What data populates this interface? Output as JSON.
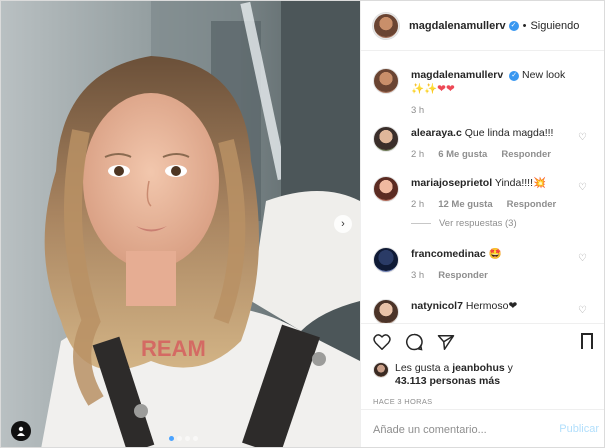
{
  "post": {
    "author": "magdalenamullerv",
    "follow_status": "Siguiendo",
    "caption_user": "magdalenamullerv",
    "caption_text": "New look",
    "caption_emojis": "✨✨❤❤",
    "caption_time": "3 h"
  },
  "comments": [
    {
      "user": "alearaya.c",
      "text": "Que linda magda!!!",
      "time": "2 h",
      "likes": "6 Me gusta",
      "reply": "Responder"
    },
    {
      "user": "mariajoseprietol",
      "text": "Yinda!!!!💥",
      "time": "2 h",
      "likes": "12 Me gusta",
      "reply": "Responder",
      "view_replies": "Ver respuestas (3)"
    },
    {
      "user": "francomedinac",
      "text": "🤩",
      "time": "3 h",
      "reply": "Responder"
    },
    {
      "user": "natynicol7",
      "text": "Hermoso❤"
    }
  ],
  "likes": {
    "prefix": "Les gusta a ",
    "user": "jeanbohus",
    "suffix": " y",
    "count_text": "43.113 personas más"
  },
  "timestamp": "HACE 3 HORAS",
  "composer": {
    "placeholder": "Añade un comentario...",
    "publish": "Publicar"
  },
  "icons": {
    "like": "heart-icon",
    "comment": "comment-icon",
    "share": "share-icon",
    "save": "bookmark-icon"
  },
  "colors": {
    "verified": "#3897f0",
    "heart": "#ed4956",
    "muted": "#8e8e8e",
    "publish": "#b2dffc"
  }
}
